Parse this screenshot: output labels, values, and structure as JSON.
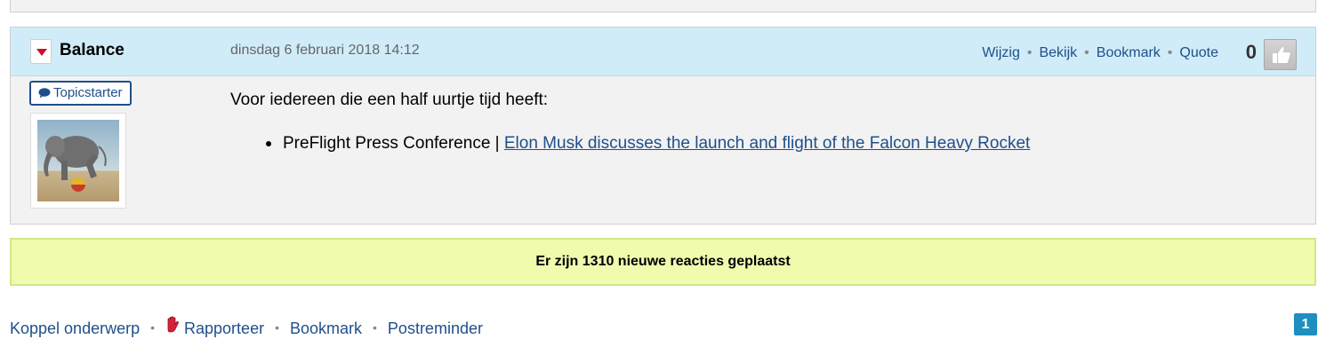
{
  "post": {
    "username": "Balance",
    "date": "dinsdag 6 februari 2018 14:12",
    "actions": [
      "Wijzig",
      "Bekijk",
      "Bookmark",
      "Quote"
    ],
    "score": "0",
    "badge": "Topicstarter",
    "body_intro": "Voor iedereen die een half uurtje tijd heeft:",
    "list_prefix": "PreFlight Press Conference | ",
    "list_link": "Elon Musk discusses the launch and flight of the Falcon Heavy Rocket"
  },
  "notice": {
    "text": "Er zijn 1310 nieuwe reacties geplaatst",
    "background": "#f0fbae"
  },
  "footer": {
    "link1": "Koppel onderwerp",
    "link2": "Rapporteer",
    "link3": "Bookmark",
    "link4": "Postreminder"
  },
  "pagination": {
    "current": "1"
  },
  "colors": {
    "header_bg": "#d0ecf8",
    "link": "#1f4f8b",
    "post_bg": "#f2f2f2",
    "page_badge": "#1f8fc0"
  },
  "icons": {
    "toggle": "triangle-down-icon",
    "like": "thumbs-up-icon",
    "badge": "speech-bubble-icon",
    "report": "hand-icon"
  }
}
